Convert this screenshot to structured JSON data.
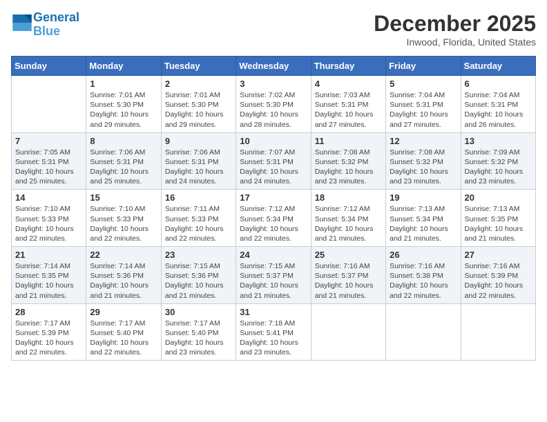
{
  "header": {
    "logo_line1": "General",
    "logo_line2": "Blue",
    "month": "December 2025",
    "location": "Inwood, Florida, United States"
  },
  "weekdays": [
    "Sunday",
    "Monday",
    "Tuesday",
    "Wednesday",
    "Thursday",
    "Friday",
    "Saturday"
  ],
  "rows": [
    {
      "cells": [
        {
          "day": "",
          "info": ""
        },
        {
          "day": "1",
          "info": "Sunrise: 7:01 AM\nSunset: 5:30 PM\nDaylight: 10 hours\nand 29 minutes."
        },
        {
          "day": "2",
          "info": "Sunrise: 7:01 AM\nSunset: 5:30 PM\nDaylight: 10 hours\nand 29 minutes."
        },
        {
          "day": "3",
          "info": "Sunrise: 7:02 AM\nSunset: 5:30 PM\nDaylight: 10 hours\nand 28 minutes."
        },
        {
          "day": "4",
          "info": "Sunrise: 7:03 AM\nSunset: 5:31 PM\nDaylight: 10 hours\nand 27 minutes."
        },
        {
          "day": "5",
          "info": "Sunrise: 7:04 AM\nSunset: 5:31 PM\nDaylight: 10 hours\nand 27 minutes."
        },
        {
          "day": "6",
          "info": "Sunrise: 7:04 AM\nSunset: 5:31 PM\nDaylight: 10 hours\nand 26 minutes."
        }
      ]
    },
    {
      "cells": [
        {
          "day": "7",
          "info": "Sunrise: 7:05 AM\nSunset: 5:31 PM\nDaylight: 10 hours\nand 25 minutes."
        },
        {
          "day": "8",
          "info": "Sunrise: 7:06 AM\nSunset: 5:31 PM\nDaylight: 10 hours\nand 25 minutes."
        },
        {
          "day": "9",
          "info": "Sunrise: 7:06 AM\nSunset: 5:31 PM\nDaylight: 10 hours\nand 24 minutes."
        },
        {
          "day": "10",
          "info": "Sunrise: 7:07 AM\nSunset: 5:31 PM\nDaylight: 10 hours\nand 24 minutes."
        },
        {
          "day": "11",
          "info": "Sunrise: 7:08 AM\nSunset: 5:32 PM\nDaylight: 10 hours\nand 23 minutes."
        },
        {
          "day": "12",
          "info": "Sunrise: 7:08 AM\nSunset: 5:32 PM\nDaylight: 10 hours\nand 23 minutes."
        },
        {
          "day": "13",
          "info": "Sunrise: 7:09 AM\nSunset: 5:32 PM\nDaylight: 10 hours\nand 23 minutes."
        }
      ]
    },
    {
      "cells": [
        {
          "day": "14",
          "info": "Sunrise: 7:10 AM\nSunset: 5:33 PM\nDaylight: 10 hours\nand 22 minutes."
        },
        {
          "day": "15",
          "info": "Sunrise: 7:10 AM\nSunset: 5:33 PM\nDaylight: 10 hours\nand 22 minutes."
        },
        {
          "day": "16",
          "info": "Sunrise: 7:11 AM\nSunset: 5:33 PM\nDaylight: 10 hours\nand 22 minutes."
        },
        {
          "day": "17",
          "info": "Sunrise: 7:12 AM\nSunset: 5:34 PM\nDaylight: 10 hours\nand 22 minutes."
        },
        {
          "day": "18",
          "info": "Sunrise: 7:12 AM\nSunset: 5:34 PM\nDaylight: 10 hours\nand 21 minutes."
        },
        {
          "day": "19",
          "info": "Sunrise: 7:13 AM\nSunset: 5:34 PM\nDaylight: 10 hours\nand 21 minutes."
        },
        {
          "day": "20",
          "info": "Sunrise: 7:13 AM\nSunset: 5:35 PM\nDaylight: 10 hours\nand 21 minutes."
        }
      ]
    },
    {
      "cells": [
        {
          "day": "21",
          "info": "Sunrise: 7:14 AM\nSunset: 5:35 PM\nDaylight: 10 hours\nand 21 minutes."
        },
        {
          "day": "22",
          "info": "Sunrise: 7:14 AM\nSunset: 5:36 PM\nDaylight: 10 hours\nand 21 minutes."
        },
        {
          "day": "23",
          "info": "Sunrise: 7:15 AM\nSunset: 5:36 PM\nDaylight: 10 hours\nand 21 minutes."
        },
        {
          "day": "24",
          "info": "Sunrise: 7:15 AM\nSunset: 5:37 PM\nDaylight: 10 hours\nand 21 minutes."
        },
        {
          "day": "25",
          "info": "Sunrise: 7:16 AM\nSunset: 5:37 PM\nDaylight: 10 hours\nand 21 minutes."
        },
        {
          "day": "26",
          "info": "Sunrise: 7:16 AM\nSunset: 5:38 PM\nDaylight: 10 hours\nand 22 minutes."
        },
        {
          "day": "27",
          "info": "Sunrise: 7:16 AM\nSunset: 5:39 PM\nDaylight: 10 hours\nand 22 minutes."
        }
      ]
    },
    {
      "cells": [
        {
          "day": "28",
          "info": "Sunrise: 7:17 AM\nSunset: 5:39 PM\nDaylight: 10 hours\nand 22 minutes."
        },
        {
          "day": "29",
          "info": "Sunrise: 7:17 AM\nSunset: 5:40 PM\nDaylight: 10 hours\nand 22 minutes."
        },
        {
          "day": "30",
          "info": "Sunrise: 7:17 AM\nSunset: 5:40 PM\nDaylight: 10 hours\nand 23 minutes."
        },
        {
          "day": "31",
          "info": "Sunrise: 7:18 AM\nSunset: 5:41 PM\nDaylight: 10 hours\nand 23 minutes."
        },
        {
          "day": "",
          "info": ""
        },
        {
          "day": "",
          "info": ""
        },
        {
          "day": "",
          "info": ""
        }
      ]
    }
  ]
}
